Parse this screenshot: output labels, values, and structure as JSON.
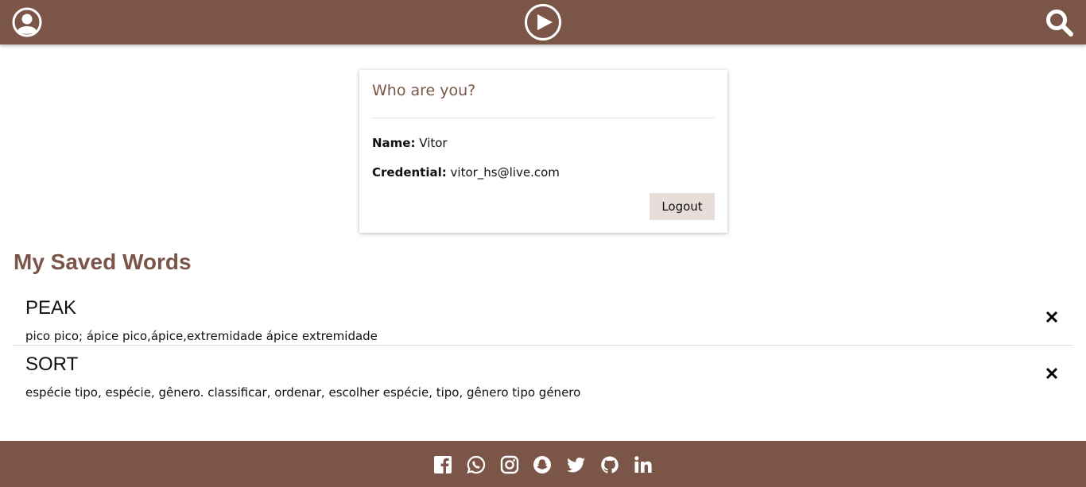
{
  "header": {
    "left_icon": "user-circle-icon",
    "center_icon": "play-circle-icon",
    "right_icon": "search-icon"
  },
  "profile_card": {
    "title": "Who are you?",
    "name_label": "Name:",
    "name_value": "Vitor",
    "credential_label": "Credential:",
    "credential_value": "vitor_hs@live.com",
    "logout_label": "Logout"
  },
  "saved_words": {
    "title": "My Saved Words",
    "items": [
      {
        "term": "PEAK",
        "meaning": "pico pico; ápice pico,ápice,extremidade ápice extremidade",
        "remove_icon": "close-icon"
      },
      {
        "term": "SORT",
        "meaning": "espécie tipo, espécie, gênero. classificar, ordenar, escolher espécie, tipo, gênero tipo género",
        "remove_icon": "close-icon"
      }
    ]
  },
  "footer": {
    "social_icons": [
      "facebook-icon",
      "whatsapp-icon",
      "instagram-icon",
      "snapchat-icon",
      "twitter-icon",
      "github-icon",
      "linkedin-icon"
    ]
  },
  "colors": {
    "brand": "#7a5548",
    "button_bg": "#e8ddd9"
  }
}
